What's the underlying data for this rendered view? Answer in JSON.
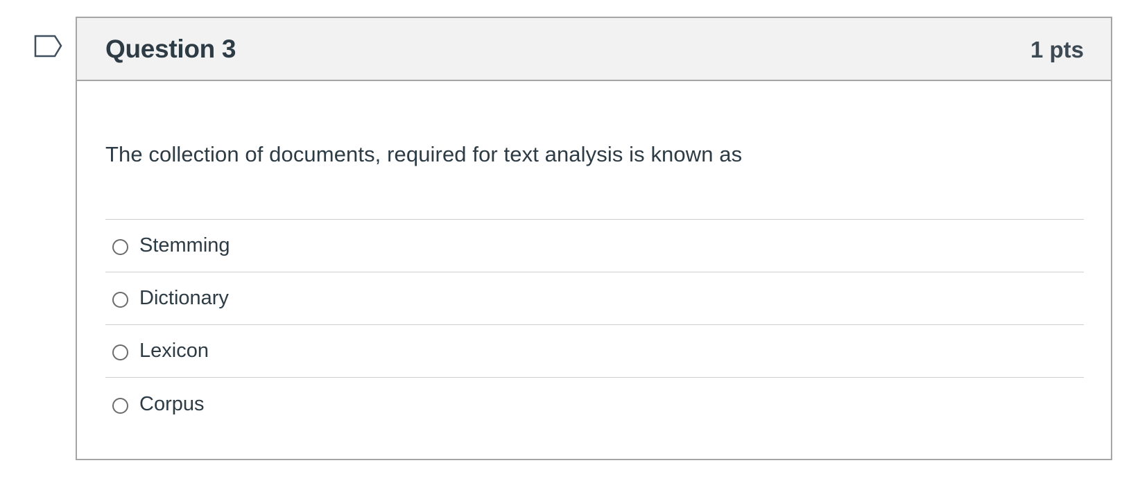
{
  "question": {
    "flag_icon": "flag-question-icon",
    "title": "Question 3",
    "points": "1 pts",
    "text": "The collection of documents, required for text analysis is known as",
    "answers": [
      {
        "label": "Stemming",
        "selected": false
      },
      {
        "label": "Dictionary",
        "selected": false
      },
      {
        "label": "Lexicon",
        "selected": false
      },
      {
        "label": "Corpus",
        "selected": false
      }
    ]
  },
  "colors": {
    "header_background": "#f2f2f2",
    "border": "#a5a5a5",
    "divider": "#cfcfcf",
    "text": "#2d3b45"
  }
}
